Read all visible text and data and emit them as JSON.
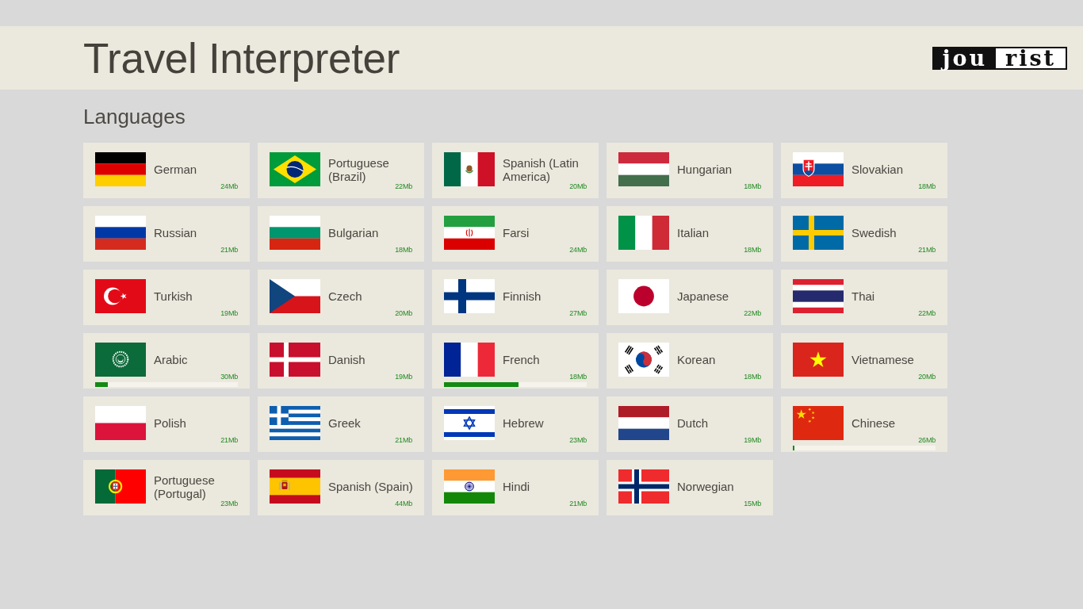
{
  "app": {
    "title": "Travel Interpreter",
    "logo": {
      "inverted_part": "jou",
      "plain_part": "rist"
    }
  },
  "section": {
    "heading": "Languages"
  },
  "languages": [
    {
      "name": "German",
      "size": "24Mb"
    },
    {
      "name": "Portuguese (Brazil)",
      "size": "22Mb"
    },
    {
      "name": "Spanish (Latin America)",
      "size": "20Mb"
    },
    {
      "name": "Hungarian",
      "size": "18Mb"
    },
    {
      "name": "Slovakian",
      "size": "18Mb"
    },
    {
      "name": "Russian",
      "size": "21Mb"
    },
    {
      "name": "Bulgarian",
      "size": "18Mb"
    },
    {
      "name": "Farsi",
      "size": "24Mb"
    },
    {
      "name": "Italian",
      "size": "18Mb"
    },
    {
      "name": "Swedish",
      "size": "21Mb"
    },
    {
      "name": "Turkish",
      "size": "19Mb"
    },
    {
      "name": "Czech",
      "size": "20Mb"
    },
    {
      "name": "Finnish",
      "size": "27Mb"
    },
    {
      "name": "Japanese",
      "size": "22Mb"
    },
    {
      "name": "Thai",
      "size": "22Mb"
    },
    {
      "name": "Arabic",
      "size": "30Mb",
      "level": 0.09
    },
    {
      "name": "Danish",
      "size": "19Mb"
    },
    {
      "name": "French",
      "size": "18Mb",
      "level": 0.52
    },
    {
      "name": "Korean",
      "size": "18Mb"
    },
    {
      "name": "Vietnamese",
      "size": "20Mb"
    },
    {
      "name": "Polish",
      "size": "21Mb"
    },
    {
      "name": "Greek",
      "size": "21Mb"
    },
    {
      "name": "Hebrew",
      "size": "23Mb"
    },
    {
      "name": "Dutch",
      "size": "19Mb"
    },
    {
      "name": "Chinese",
      "size": "26Mb",
      "level": 0.01
    },
    {
      "name": "Portuguese (Portugal)",
      "size": "23Mb"
    },
    {
      "name": "Spanish (Spain)",
      "size": "44Mb"
    },
    {
      "name": "Hindi",
      "size": "21Mb"
    },
    {
      "name": "Norwegian",
      "size": "15Mb"
    }
  ]
}
